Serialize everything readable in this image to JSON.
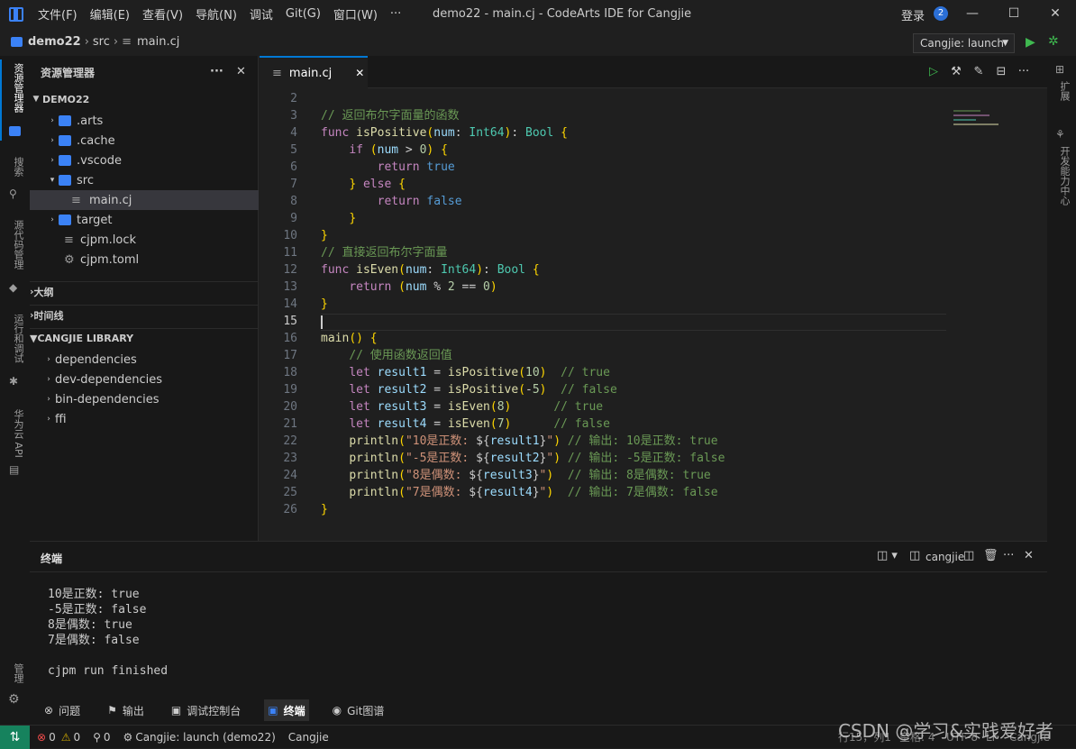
{
  "window": {
    "title": "demo22 - main.cj - CodeArts IDE for Cangjie",
    "login": "登录",
    "badge": "2"
  },
  "menu": [
    "文件(F)",
    "编辑(E)",
    "查看(V)",
    "导航(N)",
    "调试",
    "Git(G)",
    "窗口(W)",
    "···"
  ],
  "breadcrumb": {
    "project": "demo22",
    "folder": "src",
    "file": "main.cj"
  },
  "run_config": "Cangjie: launch",
  "activity": [
    "资源管理器",
    "搜索",
    "源代码管理",
    "运行和调试",
    "华为云 API",
    "管理"
  ],
  "right_activity": [
    "扩展",
    "开发能力中心"
  ],
  "explorer": {
    "title": "资源管理器",
    "root": "DEMO22",
    "items": [
      ".arts",
      ".cache",
      ".vscode",
      "src",
      "main.cj",
      "target",
      "cjpm.lock",
      "cjpm.toml"
    ],
    "sections": [
      "大纲",
      "时间线",
      "CANGJIE LIBRARY"
    ],
    "library": [
      "dependencies",
      "dev-dependencies",
      "bin-dependencies",
      "ffi"
    ]
  },
  "editor": {
    "tab": "main.cj",
    "line_numbers": [
      "2",
      "3",
      "4",
      "5",
      "6",
      "7",
      "8",
      "9",
      "10",
      "11",
      "12",
      "13",
      "14",
      "15",
      "16",
      "17",
      "18",
      "19",
      "20",
      "21",
      "22",
      "23",
      "24",
      "25",
      "26"
    ]
  },
  "panel": {
    "title": "终端",
    "shell": "cangjie",
    "output": [
      "10是正数: true",
      "-5是正数: false",
      "8是偶数: true",
      "7是偶数: false",
      "",
      "cjpm run finished"
    ],
    "tabs": [
      "问题",
      "输出",
      "调试控制台",
      "终端",
      "Git图谱"
    ]
  },
  "status": {
    "errors": "0",
    "warnings": "0",
    "ports": "0",
    "launch": "Cangjie: launch (demo22)",
    "lang": "Cangjie",
    "position": "行15，列1",
    "spaces": "空格: 4",
    "encoding": "UTF-8",
    "eol": "LF",
    "mode": "Cangjie"
  },
  "watermark": "CSDN @学习&实践爱好者"
}
